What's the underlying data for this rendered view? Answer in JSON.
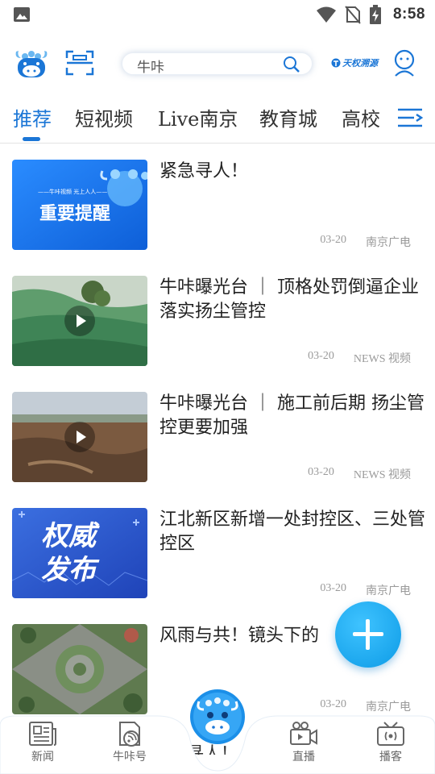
{
  "status_bar": {
    "time": "8:58"
  },
  "header": {
    "search_text": "牛咔",
    "brand_text": "天权溯源"
  },
  "tabs": [
    {
      "label": "推荐",
      "active": true
    },
    {
      "label": "短视频"
    },
    {
      "label": "Live南京"
    },
    {
      "label": "教育城"
    },
    {
      "label": "高校"
    }
  ],
  "news": [
    {
      "title": "紧急寻人！",
      "date": "03-20",
      "source": "南京广电",
      "thumb_text": "重要提醒",
      "thumb_subtext": "——牛咔视频 光上人人——",
      "video": false
    },
    {
      "title": "牛咔曝光台 ｜ 顶格处罚倒逼企业落实扬尘管控",
      "date": "03-20",
      "source": "NEWS 视频",
      "video": true
    },
    {
      "title": "牛咔曝光台 ｜ 施工前后期 扬尘管控更要加强",
      "date": "03-20",
      "source": "NEWS 视频",
      "video": true
    },
    {
      "title": "江北新区新增一处封控区、三处管控区",
      "date": "03-20",
      "source": "南京广电",
      "thumb_text_1": "权威",
      "thumb_text_2": "发布",
      "video": false
    },
    {
      "title": "风雨与共！镜头下的",
      "date": "03-20",
      "source": "南京广电",
      "video": false
    }
  ],
  "bottom_nav": [
    {
      "label": "新闻"
    },
    {
      "label": "牛咔号"
    },
    {
      "label": "直播"
    },
    {
      "label": "播客"
    }
  ],
  "bottom_partial_text": "寻人！",
  "colors": {
    "accent": "#1b76d6",
    "fab": "#1aa8f0"
  }
}
